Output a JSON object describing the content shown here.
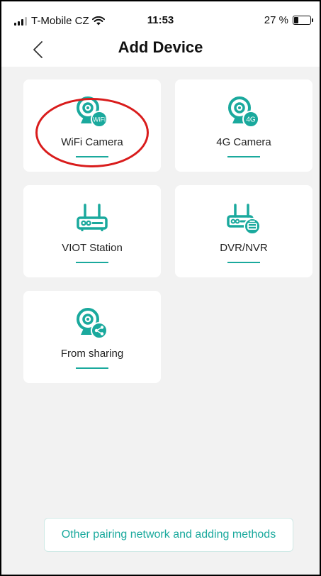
{
  "status_bar": {
    "carrier": "T-Mobile CZ",
    "time": "11:53",
    "battery": "27 %"
  },
  "header": {
    "title": "Add Device"
  },
  "devices": [
    {
      "label": "WiFi Camera",
      "icon": "wifi-camera-icon"
    },
    {
      "label": "4G Camera",
      "icon": "4g-camera-icon"
    },
    {
      "label": "VIOT Station",
      "icon": "station-icon"
    },
    {
      "label": "DVR/NVR",
      "icon": "dvr-nvr-icon"
    },
    {
      "label": "From sharing",
      "icon": "sharing-camera-icon"
    }
  ],
  "icon_badges": {
    "wifi": "WiFi",
    "fourg": "4G"
  },
  "footer": {
    "other_methods_label": "Other pairing network and adding methods"
  },
  "colors": {
    "accent": "#1aa99d",
    "highlight": "#d91c1c",
    "background": "#f2f2f2"
  }
}
